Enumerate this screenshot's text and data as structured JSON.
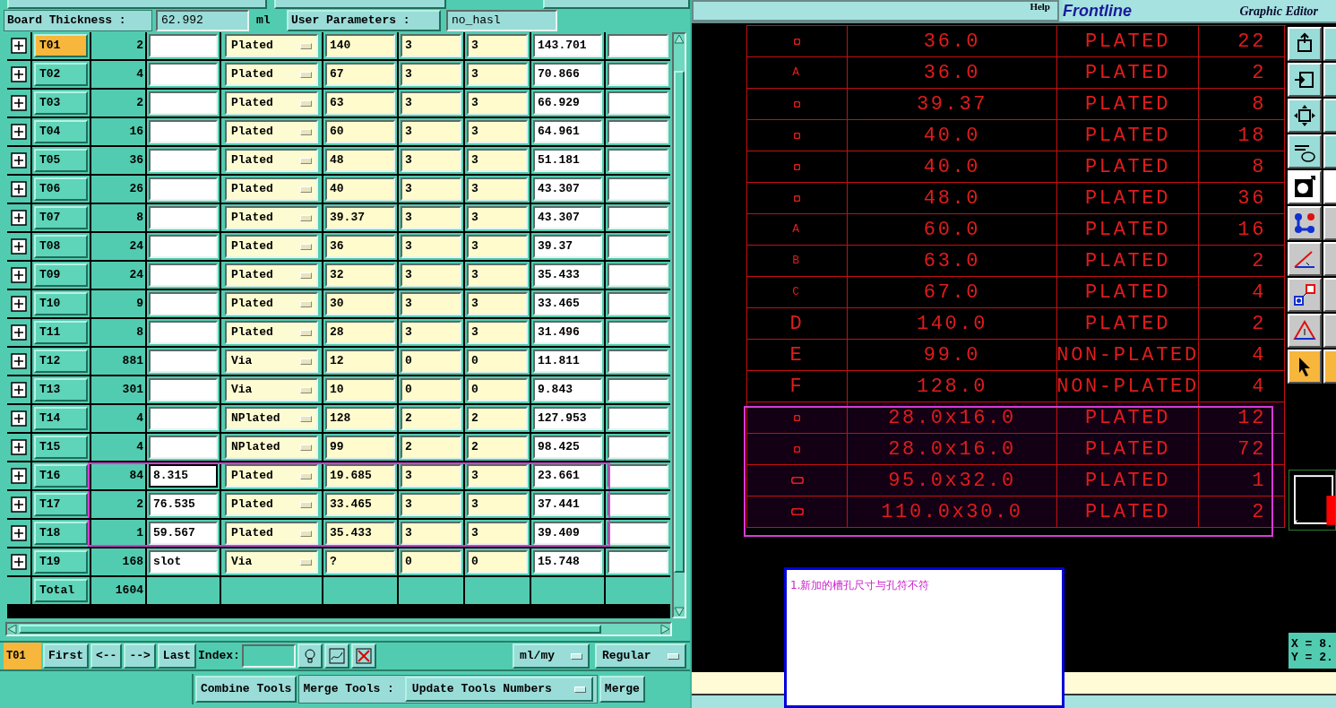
{
  "header": {
    "board_thickness_label": "Board Thickness :",
    "board_thickness": "62.992",
    "unit": "ml",
    "user_params_label": "User Parameters :",
    "user_params": "no_hasl"
  },
  "tools": [
    {
      "tool": "T01",
      "selected": true,
      "count": "2",
      "plating": "Plated",
      "finish": "140",
      "plus_tol": "3",
      "minus_tol": "3",
      "drill": "143.701",
      "focused": false,
      "highlighted": false
    },
    {
      "tool": "T02",
      "selected": false,
      "count": "4",
      "plating": "Plated",
      "finish": "67",
      "plus_tol": "3",
      "minus_tol": "3",
      "drill": "70.866",
      "focused": false,
      "highlighted": false
    },
    {
      "tool": "T03",
      "selected": false,
      "count": "2",
      "plating": "Plated",
      "finish": "63",
      "plus_tol": "3",
      "minus_tol": "3",
      "drill": "66.929",
      "focused": false,
      "highlighted": false
    },
    {
      "tool": "T04",
      "selected": false,
      "count": "16",
      "plating": "Plated",
      "finish": "60",
      "plus_tol": "3",
      "minus_tol": "3",
      "drill": "64.961",
      "focused": false,
      "highlighted": false
    },
    {
      "tool": "T05",
      "selected": false,
      "count": "36",
      "plating": "Plated",
      "finish": "48",
      "plus_tol": "3",
      "minus_tol": "3",
      "drill": "51.181",
      "focused": false,
      "highlighted": false
    },
    {
      "tool": "T06",
      "selected": false,
      "count": "26",
      "plating": "Plated",
      "finish": "40",
      "plus_tol": "3",
      "minus_tol": "3",
      "drill": "43.307",
      "focused": false,
      "highlighted": false
    },
    {
      "tool": "T07",
      "selected": false,
      "count": "8",
      "plating": "Plated",
      "finish": "39.37",
      "plus_tol": "3",
      "minus_tol": "3",
      "drill": "43.307",
      "focused": false,
      "highlighted": false
    },
    {
      "tool": "T08",
      "selected": false,
      "count": "24",
      "plating": "Plated",
      "finish": "36",
      "plus_tol": "3",
      "minus_tol": "3",
      "drill": "39.37",
      "focused": false,
      "highlighted": false
    },
    {
      "tool": "T09",
      "selected": false,
      "count": "24",
      "plating": "Plated",
      "finish": "32",
      "plus_tol": "3",
      "minus_tol": "3",
      "drill": "35.433",
      "focused": false,
      "highlighted": false
    },
    {
      "tool": "T10",
      "selected": false,
      "count": "9",
      "plating": "Plated",
      "finish": "30",
      "plus_tol": "3",
      "minus_tol": "3",
      "drill": "33.465",
      "focused": false,
      "highlighted": false
    },
    {
      "tool": "T11",
      "selected": false,
      "count": "8",
      "plating": "Plated",
      "finish": "28",
      "plus_tol": "3",
      "minus_tol": "3",
      "drill": "31.496",
      "focused": false,
      "highlighted": false
    },
    {
      "tool": "T12",
      "selected": false,
      "count": "881",
      "plating": "Via",
      "finish": "12",
      "plus_tol": "0",
      "minus_tol": "0",
      "drill": "11.811",
      "focused": false,
      "highlighted": false
    },
    {
      "tool": "T13",
      "selected": false,
      "count": "301",
      "plating": "Via",
      "finish": "10",
      "plus_tol": "0",
      "minus_tol": "0",
      "drill": "9.843",
      "focused": false,
      "highlighted": false
    },
    {
      "tool": "T14",
      "selected": false,
      "count": "4",
      "plating": "NPlated",
      "finish": "128",
      "plus_tol": "2",
      "minus_tol": "2",
      "drill": "127.953",
      "focused": false,
      "highlighted": false
    },
    {
      "tool": "T15",
      "selected": false,
      "count": "4",
      "plating": "NPlated",
      "finish": "99",
      "plus_tol": "2",
      "minus_tol": "2",
      "drill": "98.425",
      "focused": false,
      "highlighted": false
    },
    {
      "tool": "T16",
      "selected": false,
      "count": "84",
      "note": "8.315",
      "plating": "Plated",
      "finish": "19.685",
      "plus_tol": "3",
      "minus_tol": "3",
      "drill": "23.661",
      "focused": true,
      "highlighted": true
    },
    {
      "tool": "T17",
      "selected": false,
      "count": "2",
      "note": "76.535",
      "plating": "Plated",
      "finish": "33.465",
      "plus_tol": "3",
      "minus_tol": "3",
      "drill": "37.441",
      "focused": false,
      "highlighted": true
    },
    {
      "tool": "T18",
      "selected": false,
      "count": "1",
      "note": "59.567",
      "plating": "Plated",
      "finish": "35.433",
      "plus_tol": "3",
      "minus_tol": "3",
      "drill": "39.409",
      "focused": false,
      "highlighted": true
    },
    {
      "tool": "T19",
      "selected": false,
      "count": "168",
      "note": "slot",
      "plating": "Via",
      "finish": "?",
      "plus_tol": "0",
      "minus_tol": "0",
      "drill": "15.748",
      "focused": false,
      "highlighted": false
    }
  ],
  "total": {
    "label": "Total",
    "count": "1604"
  },
  "nav": {
    "current": "T01",
    "buttons": [
      "First",
      "<--",
      "-->",
      "Last"
    ],
    "index_label": "Index:",
    "units": "ml/my",
    "mode": "Regular"
  },
  "actions": {
    "combine": "Combine Tools",
    "merge_label": "Merge Tools :",
    "merge_mode": "Update Tools Numbers",
    "merge": "Merge"
  },
  "editor": {
    "help": "Help",
    "logo": "Frontline",
    "subtitle": "Graphic Editor",
    "drill_table": [
      {
        "symbol": {
          "kind": "mark"
        },
        "size": "36.0",
        "type": "PLATED",
        "count": "22",
        "highlighted": false
      },
      {
        "symbol": {
          "kind": "small_letter",
          "text": "A"
        },
        "size": "36.0",
        "type": "PLATED",
        "count": "2",
        "highlighted": false
      },
      {
        "symbol": {
          "kind": "mark"
        },
        "size": "39.37",
        "type": "PLATED",
        "count": "8",
        "highlighted": false
      },
      {
        "symbol": {
          "kind": "mark"
        },
        "size": "40.0",
        "type": "PLATED",
        "count": "18",
        "highlighted": false
      },
      {
        "symbol": {
          "kind": "mark"
        },
        "size": "40.0",
        "type": "PLATED",
        "count": "8",
        "highlighted": false
      },
      {
        "symbol": {
          "kind": "mark"
        },
        "size": "48.0",
        "type": "PLATED",
        "count": "36",
        "highlighted": false
      },
      {
        "symbol": {
          "kind": "small_letter",
          "text": "A"
        },
        "size": "60.0",
        "type": "PLATED",
        "count": "16",
        "highlighted": false
      },
      {
        "symbol": {
          "kind": "small_letter",
          "text": "B"
        },
        "size": "63.0",
        "type": "PLATED",
        "count": "2",
        "highlighted": false
      },
      {
        "symbol": {
          "kind": "small_letter",
          "text": "C"
        },
        "size": "67.0",
        "type": "PLATED",
        "count": "4",
        "highlighted": false
      },
      {
        "symbol": {
          "kind": "letter",
          "text": "D"
        },
        "size": "140.0",
        "type": "PLATED",
        "count": "2",
        "highlighted": false
      },
      {
        "symbol": {
          "kind": "letter",
          "text": "E"
        },
        "size": "99.0",
        "type": "NON-PLATED",
        "count": "4",
        "highlighted": false
      },
      {
        "symbol": {
          "kind": "letter",
          "text": "F"
        },
        "size": "128.0",
        "type": "NON-PLATED",
        "count": "4",
        "highlighted": false
      }
    ],
    "flagged_rows": [
      {
        "symbol": {
          "kind": "mark"
        },
        "size": "28.0x16.0",
        "type": "PLATED",
        "count": "12",
        "highlighted": true
      },
      {
        "symbol": {
          "kind": "mark"
        },
        "size": "28.0x16.0",
        "type": "PLATED",
        "count": "72",
        "highlighted": true
      },
      {
        "symbol": {
          "kind": "slot"
        },
        "size": "95.0x32.0",
        "type": "PLATED",
        "count": "1",
        "highlighted": true
      },
      {
        "symbol": {
          "kind": "slot"
        },
        "size": "110.0x30.0",
        "type": "PLATED",
        "count": "2",
        "highlighted": true
      }
    ],
    "note": "1.新加的槽孔尺寸与孔符不符",
    "coords": [
      "X = 8.",
      "Y = 2."
    ]
  }
}
